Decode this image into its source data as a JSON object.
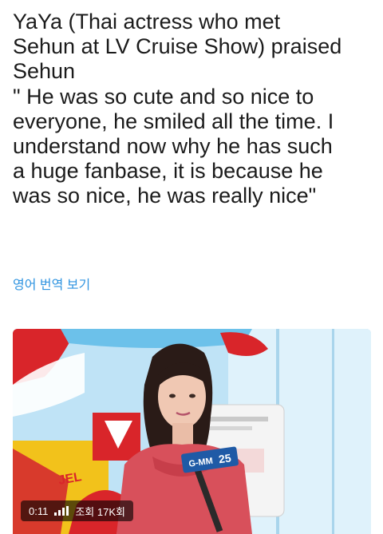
{
  "tweet": {
    "text": "YaYa (Thai actress who met\nSehun at LV Cruise Show) praised\nSehun\n\" He was so cute and so nice to\neveryone, he smiled all the time. I\nunderstand now why he has such\na huge fanbase, it is because he\nwas so nice, he was really nice\"",
    "translate_label": "영어 번역 보기"
  },
  "media": {
    "time": "0:11",
    "views": "조회 17K회",
    "mic_flag_left": "G-MM",
    "mic_flag_right": "25",
    "logo_letters": "JEL",
    "icons": [
      "volume-bars-icon"
    ]
  }
}
